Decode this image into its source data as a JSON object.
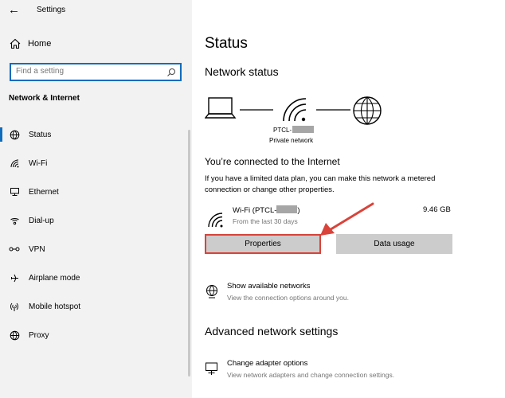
{
  "window": {
    "title": "Settings",
    "back_glyph": "←",
    "minimize_glyph": "—",
    "maximize_glyph": "☐",
    "close_glyph": "✕"
  },
  "sidebar": {
    "home_label": "Home",
    "search_placeholder": "Find a setting",
    "section_title": "Network & Internet",
    "items": [
      {
        "label": "Status",
        "icon": "globe-status-icon",
        "active": true
      },
      {
        "label": "Wi-Fi",
        "icon": "wifi-icon",
        "active": false
      },
      {
        "label": "Ethernet",
        "icon": "ethernet-icon",
        "active": false
      },
      {
        "label": "Dial-up",
        "icon": "dialup-icon",
        "active": false
      },
      {
        "label": "VPN",
        "icon": "vpn-icon",
        "active": false
      },
      {
        "label": "Airplane mode",
        "icon": "airplane-icon",
        "active": false
      },
      {
        "label": "Mobile hotspot",
        "icon": "hotspot-icon",
        "active": false
      },
      {
        "label": "Proxy",
        "icon": "globe-icon",
        "active": false
      }
    ]
  },
  "main": {
    "title": "Status",
    "network_status_title": "Network status",
    "network_name": "PTCL-",
    "network_type": "Private network",
    "connected_title": "You’re connected to the Internet",
    "connected_desc": "If you have a limited data plan, you can make this network a metered connection or change other properties.",
    "connection": {
      "name": "Wi-Fi (PTCL-",
      "name_suffix": ")",
      "period": "From the last 30 days",
      "usage": "9.46 GB"
    },
    "buttons": {
      "properties": "Properties",
      "data_usage": "Data usage"
    },
    "show_networks": {
      "label": "Show available networks",
      "desc": "View the connection options around you."
    },
    "advanced_title": "Advanced network settings",
    "adapter_options": {
      "label": "Change adapter options",
      "desc": "View network adapters and change connection settings."
    }
  },
  "colors": {
    "accent": "#0f6cbd",
    "highlight": "#d9433a",
    "sidebar_bg": "#f2f2f2",
    "button_bg": "#cccccc"
  }
}
